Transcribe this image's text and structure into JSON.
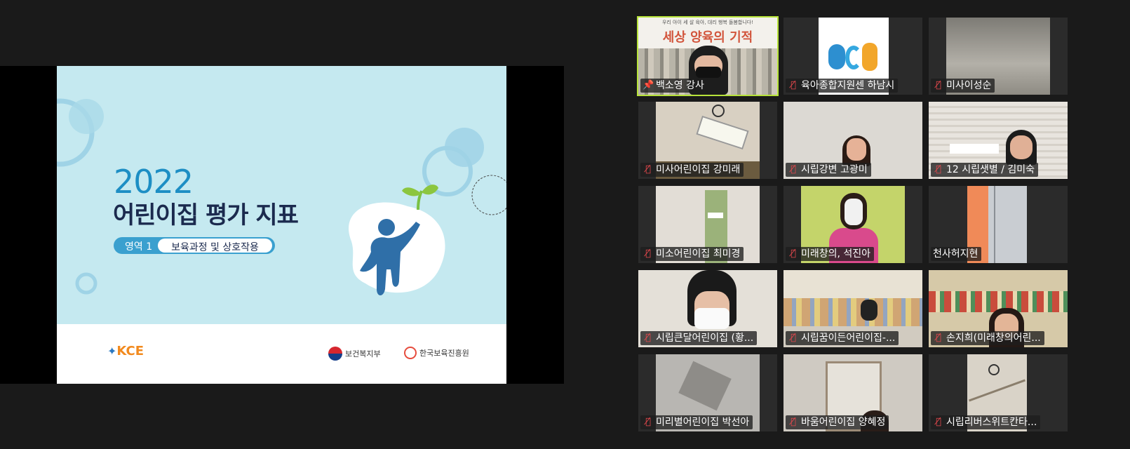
{
  "share": {
    "slide": {
      "year": "2022",
      "title": "어린이집 평가 지표",
      "area_label": "영역 1",
      "area_name": "보육과정 및 상호작용",
      "logos": {
        "kce": "KCE",
        "mohw": "보건복지부",
        "kcpi": "한국보육진흥원"
      }
    }
  },
  "tile0_banner": {
    "top": "우리 아이 세 살 육아, 대리 행복 돌봄합니다!",
    "title": "세상 양육의 기적"
  },
  "participants": [
    {
      "name": "백소영 강사",
      "status": "pinned",
      "active": true
    },
    {
      "name": "육아종합지원센 하남시",
      "status": "muted"
    },
    {
      "name": "미사이성순",
      "status": "muted"
    },
    {
      "name": "미사어린이집 강미래",
      "status": "muted"
    },
    {
      "name": "시립강변 고광미",
      "status": "muted"
    },
    {
      "name": "12 시립샛별 / 김미숙",
      "status": "muted"
    },
    {
      "name": "미소어린이집 최미경",
      "status": "muted"
    },
    {
      "name": "미래창의, 석진아",
      "status": "muted"
    },
    {
      "name": "천사허지현",
      "status": "none"
    },
    {
      "name": "시립큰달어린이집 (황...",
      "status": "muted"
    },
    {
      "name": "시립꿈이든어린이집-...",
      "status": "muted"
    },
    {
      "name": "손지희(미래창의어린...",
      "status": "muted"
    },
    {
      "name": "미리별어린이집 박선아",
      "status": "muted"
    },
    {
      "name": "바움어린이집 양혜정",
      "status": "muted"
    },
    {
      "name": "시립리버스위트칸타...",
      "status": "muted"
    }
  ],
  "icons": {
    "muted": "mic-muted-icon",
    "pinned": "pin-icon"
  },
  "colors": {
    "active_border": "#b7e33a",
    "muted_icon": "#e5484d",
    "slide_bg": "#c5e9f0"
  }
}
